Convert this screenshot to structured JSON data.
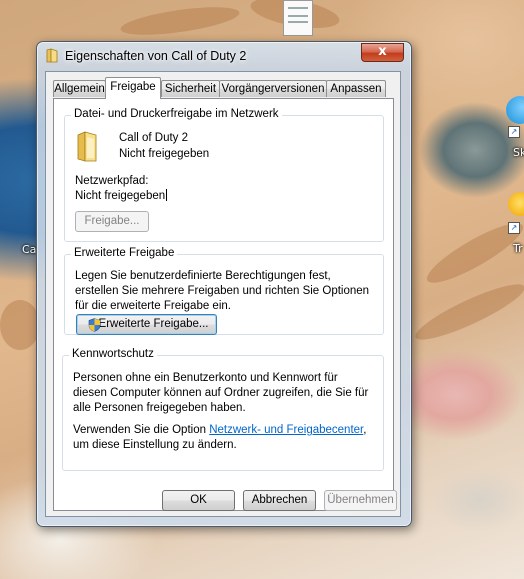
{
  "window": {
    "title": "Eigenschaften von Call of Duty 2",
    "close_glyph": "x"
  },
  "desktop": {
    "labels": [
      "Ca",
      "Sk",
      "Tr"
    ]
  },
  "tabs": [
    {
      "label": "Allgemein",
      "active": false
    },
    {
      "label": "Freigabe",
      "active": true
    },
    {
      "label": "Sicherheit",
      "active": false
    },
    {
      "label": "Vorgängerversionen",
      "active": false
    },
    {
      "label": "Anpassen",
      "active": false
    }
  ],
  "network_share": {
    "group_title": "Datei- und Druckerfreigabe im Netzwerk",
    "folder_name": "Call of Duty 2",
    "folder_status": "Nicht freigegeben",
    "path_label": "Netzwerkpfad:",
    "path_value": "Nicht freigegeben",
    "share_button": "Freigabe..."
  },
  "advanced_share": {
    "group_title": "Erweiterte Freigabe",
    "description": "Legen Sie benutzerdefinierte Berechtigungen fest, erstellen Sie mehrere Freigaben und richten Sie Optionen für die erweiterte Freigabe ein.",
    "button": "Erweiterte Freigabe..."
  },
  "password_protection": {
    "group_title": "Kennwortschutz",
    "description": "Personen ohne ein Benutzerkonto und Kennwort für diesen Computer können auf Ordner zugreifen, die Sie für alle Personen freigegeben haben.",
    "option_prefix": "Verwenden Sie die Option ",
    "option_link": "Netzwerk- und Freigabecenter",
    "option_suffix": ", um diese Einstellung zu ändern."
  },
  "footer": {
    "ok": "OK",
    "cancel": "Abbrechen",
    "apply": "Übernehmen"
  },
  "colors": {
    "link": "#0066cc",
    "close_button": "#c23d1d"
  }
}
